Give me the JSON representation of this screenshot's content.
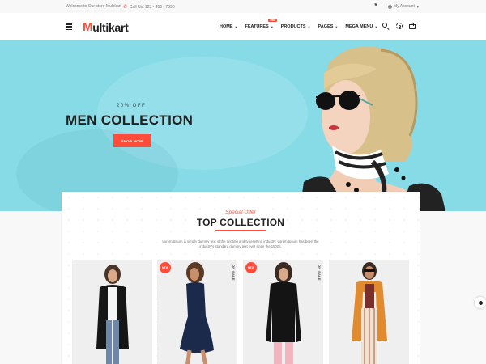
{
  "topbar": {
    "welcome": "Welcome to Our store Multikart",
    "call": "Call Us: 123 - 456 - 7890",
    "account": "My Account"
  },
  "header": {
    "logo_m": "M",
    "logo_rest": "ultikart",
    "nav": [
      {
        "label": "HOME"
      },
      {
        "label": "FEATURES",
        "badge": "new"
      },
      {
        "label": "PRODUCTS"
      },
      {
        "label": "PAGES"
      },
      {
        "label": "MEGA MENU"
      }
    ],
    "icons": [
      "menu-icon",
      "search-icon",
      "settings-icon",
      "cart-icon"
    ]
  },
  "hero": {
    "offer": "20% OFF",
    "title": "MEN COLLECTION",
    "button": "SHOP NOW"
  },
  "collection": {
    "special": "Special Offer",
    "title": "TOP COLLECTION",
    "description": "Lorem Ipsum is simply dummy text of the printing and typesetting industry. Lorem Ipsum has been the industry's standard dummy text ever since the 1500s,"
  },
  "products": [
    {
      "badge": "",
      "sale": ""
    },
    {
      "badge": "NEW",
      "sale": "ON SALE"
    },
    {
      "badge": "NEW",
      "sale": "ON SALE"
    },
    {
      "badge": "",
      "sale": ""
    }
  ],
  "colors": {
    "accent": "#ff4c3b",
    "hero_bg": "#86dbe7",
    "text": "#222222",
    "band": "#f8f8f8"
  }
}
